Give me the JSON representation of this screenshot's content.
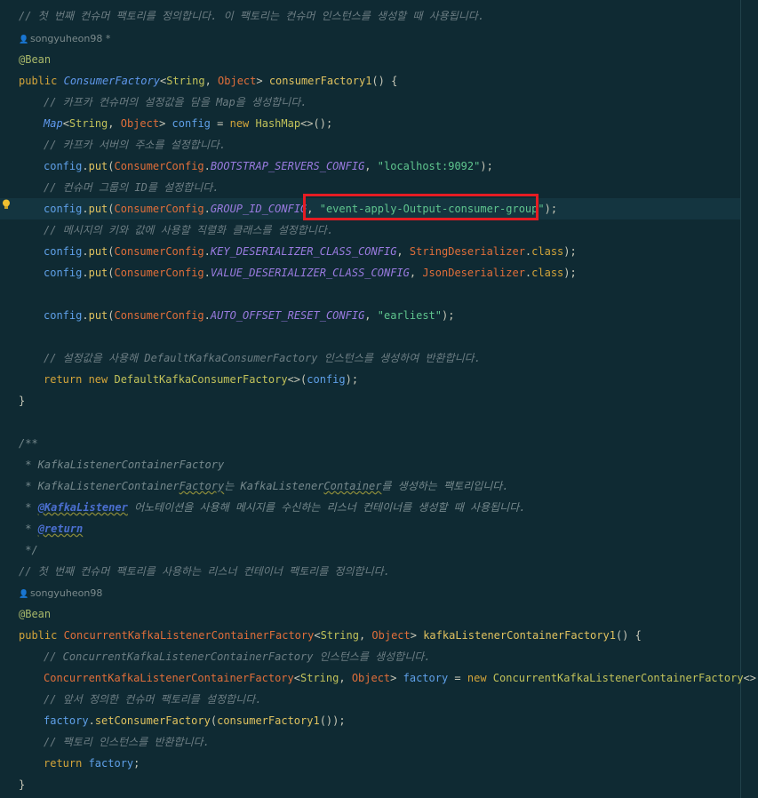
{
  "code": {
    "l1": "// 첫 번째 컨슈머 팩토리를 정의합니다. 이 팩토리는 컨슈머 인스턴스를 생성할 때 사용됩니다.",
    "author1": "songyuheon98 *",
    "l3": "@Bean",
    "l4": {
      "public": "public",
      "iface": "ConsumerFactory",
      "lt": "<",
      "string": "String",
      ",sp": ", ",
      "object": "Object",
      "gt": "> ",
      "fn": "consumerFactory1",
      "rest": "() {"
    },
    "l5": "// 카프카 컨슈머의 설정값을 담을 Map을 생성합니다.",
    "l6": {
      "map": "Map",
      "lt": "<",
      "string": "String",
      "comma": ", ",
      "object": "Object",
      "gt": "> ",
      "config": "config",
      "eq": " = ",
      "new": "new ",
      "hashmap": "HashMap",
      "rest": "<>();"
    },
    "l7": "// 카프카 서버의 주소를 설정합니다.",
    "l8": {
      "config": "config",
      ".": ".",
      "put": "put",
      "p1": "(",
      "cc": "ConsumerConfig",
      "dot": ".",
      "cst": "BOOTSTRAP_SERVERS_CONFIG",
      "comma": ", ",
      "str": "\"localhost:9092\"",
      "rest": ");"
    },
    "l9": "// 컨슈머 그룹의 ID를 설정합니다.",
    "l10": {
      "config": "config",
      ".": ".",
      "put": "put",
      "p1": "(",
      "cc": "ConsumerConfig",
      "dot": ".",
      "cst": "GROUP_ID_CONFIG",
      "comma": ", ",
      "str": "\"event-apply-Output-consumer-group\"",
      "rest": ");"
    },
    "l11": "// 메시지의 키와 값에 사용할 직렬화 클래스를 설정합니다.",
    "l12": {
      "config": "config",
      ".": ".",
      "put": "put",
      "p1": "(",
      "cc": "ConsumerConfig",
      "dot": ".",
      "cst": "KEY_DESERIALIZER_CLASS_CONFIG",
      "comma": ", ",
      "cls": "StringDeserializer",
      "dot2": ".",
      "kw": "class",
      "rest": ");"
    },
    "l13": {
      "config": "config",
      ".": ".",
      "put": "put",
      "p1": "(",
      "cc": "ConsumerConfig",
      "dot": ".",
      "cst": "VALUE_DESERIALIZER_CLASS_CONFIG",
      "comma": ", ",
      "cls": "JsonDeserializer",
      "dot2": ".",
      "kw": "class",
      "rest": ");"
    },
    "l15": {
      "config": "config",
      ".": ".",
      "put": "put",
      "p1": "(",
      "cc": "ConsumerConfig",
      "dot": ".",
      "cst": "AUTO_OFFSET_RESET_CONFIG",
      "comma": ", ",
      "str": "\"earliest\"",
      "rest": ");"
    },
    "l17": "// 설정값을 사용해 DefaultKafkaConsumerFactory 인스턴스를 생성하여 반환합니다.",
    "l18": {
      "ret": "return ",
      "new": "new ",
      "cls": "DefaultKafkaConsumerFactory",
      "p": "<>(",
      "config": "config",
      "rest": ");"
    },
    "l19": "}",
    "l21": "/**",
    "l22": " * KafkaListenerContainerFactory",
    "l23": {
      "a": " * KafkaListenerContainer",
      "b": "Factory",
      "c": "는 KafkaListener",
      "d": "Container",
      "e": "를 생성하는 팩토리입니다."
    },
    "l24": {
      "star": " * ",
      "tag": "@KafkaListener",
      "rest": " 어노테이션을 사용해 메시지를 수신하는 리스너 컨테이너를 생성할 때 사용됩니다."
    },
    "l25": {
      "star": " * ",
      "tag": "@return"
    },
    "l26": " */",
    "l27": "// 첫 번째 컨슈머 팩토리를 사용하는 리스너 컨테이너 팩토리를 정의합니다.",
    "author2": "songyuheon98",
    "l29": "@Bean",
    "l30": {
      "public": "public ",
      "cls": "ConcurrentKafkaListenerContainerFactory",
      "lt": "<",
      "string": "String",
      "comma": ", ",
      "object": "Object",
      "gt": "> ",
      "fn": "kafkaListenerContainerFactory1",
      "rest": "() {"
    },
    "l31": "// ConcurrentKafkaListenerContainerFactory 인스턴스를 생성합니다.",
    "l32": {
      "cls": "ConcurrentKafkaListenerContainerFactory",
      "lt": "<",
      "string": "String",
      "comma": ", ",
      "object": "Object",
      "gt": "> ",
      "var": "factory",
      "eq": " = ",
      "new": "new ",
      "cls2": "ConcurrentKafkaListenerContainerFactory",
      "rest": "<>();"
    },
    "l33": "// 앞서 정의한 컨슈머 팩토리를 설정합니다.",
    "l34": {
      "factory": "factory",
      ".": ".",
      "fn": "setConsumerFactory",
      "p": "(",
      "fn2": "consumerFactory1",
      "rest": "());"
    },
    "l35": "// 팩토리 인스턴스를 반환합니다.",
    "l36": {
      "ret": "return ",
      "var": "factory",
      "rest": ";"
    },
    "l37": "}"
  },
  "colors": {
    "background": "#0f2a33",
    "highlight": "#e51c23",
    "string": "#5fc58e",
    "keyword": "#d3a43a"
  },
  "icons": {
    "author": "person-icon",
    "intention": "lightbulb-icon"
  }
}
